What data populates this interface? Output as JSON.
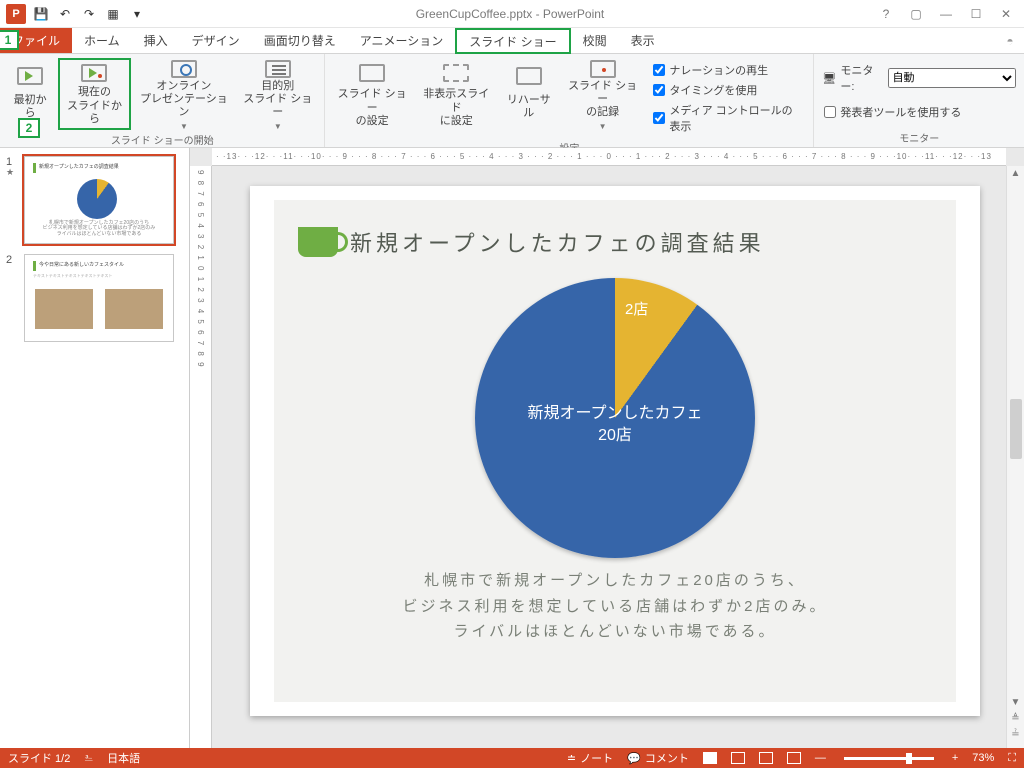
{
  "window": {
    "title": "GreenCupCoffee.pptx - PowerPoint"
  },
  "tabs": {
    "file": "ファイル",
    "home": "ホーム",
    "insert": "挿入",
    "design": "デザイン",
    "transitions": "画面切り替え",
    "animations": "アニメーション",
    "slideshow": "スライド ショー",
    "review": "校閲",
    "view": "表示"
  },
  "ribbon": {
    "start_group_label": "スライド ショーの開始",
    "from_beginning": "最初から",
    "from_current": "現在の\nスライドから",
    "online": "オンライン\nプレゼンテーション",
    "custom": "目的別\nスライド ショー",
    "setup_group_label": "設定",
    "setup": "スライド ショー\nの設定",
    "hide": "非表示スライド\nに設定",
    "rehearse": "リハーサル",
    "record": "スライド ショー\nの記録",
    "chk_narration": "ナレーションの再生",
    "chk_timing": "タイミングを使用",
    "chk_media": "メディア コントロールの表示",
    "monitor_group_label": "モニター",
    "monitor_label": "モニター:",
    "monitor_value": "自動",
    "presenter_view": "発表者ツールを使用する"
  },
  "callouts": {
    "one": "1",
    "two": "2"
  },
  "ruler": {
    "h": "· ·13· · ·12· · ·11· · ·10· · · 9 · · · 8 · · · 7 · · · 6 · · · 5 · · · 4 · · · 3 · · · 2 · · · 1 · · · 0 · · · 1 · · · 2 · · · 3 · · · 4 · · · 5 · · · 6 · · · 7 · · · 8 · · · 9 · · ·10· · ·11· · ·12· · ·13",
    "v": "9  8  7  6  5  4  3  2  1  0  1  2  3  4  5  6  7  8  9"
  },
  "slide": {
    "title": "新規オープンしたカフェの調査結果",
    "desc_l1": "札幌市で新規オープンしたカフェ20店のうち、",
    "desc_l2": "ビジネス利用を想定している店舗はわずか2店のみ。",
    "desc_l3": "ライバルはほとんどいない市場である。"
  },
  "chart_data": {
    "type": "pie",
    "title": "新規オープンしたカフェの調査結果",
    "slices": [
      {
        "label": "新規オープンしたカフェ\n20店",
        "value": 18
      },
      {
        "label": "2店",
        "value": 2
      }
    ],
    "colors": [
      "#3665a9",
      "#e5b431"
    ]
  },
  "thumbs": {
    "n1": "1",
    "n2": "2",
    "t1_bar": "新規オープンしたカフェの調査結果",
    "t2_bar": "今や日常にある新しいカフェスタイル"
  },
  "status": {
    "slide": "スライド 1/2",
    "lang": "日本語",
    "notes": "ノート",
    "comments": "コメント",
    "zoom": "73%"
  }
}
